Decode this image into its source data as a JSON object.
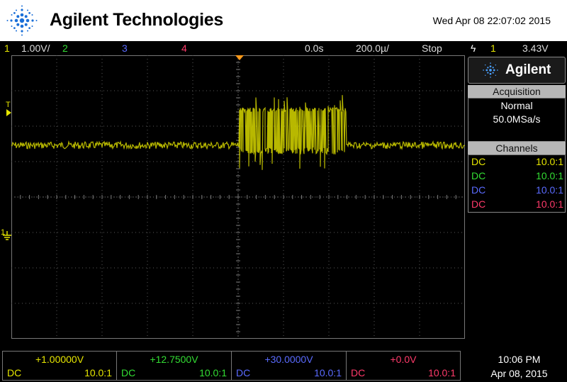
{
  "header": {
    "brand": "Agilent Technologies",
    "datetime": "Wed Apr 08 22:07:02 2015"
  },
  "status": {
    "ch1_num": "1",
    "ch1_scale": "1.00V/",
    "ch2_num": "2",
    "ch3_num": "3",
    "ch4_num": "4",
    "time_offset": "0.0s",
    "time_scale": "200.0µ/",
    "run_state": "Stop",
    "trigger_icon": "ϟ",
    "trigger_source": "1",
    "trigger_level": "3.43V"
  },
  "side": {
    "logo_text": "Agilent",
    "acq_header": "Acquisition",
    "acq_mode": "Normal",
    "sample_rate": "50.0MSa/s",
    "channels_header": "Channels",
    "channels": [
      {
        "coupling": "DC",
        "probe": "10.0:1",
        "color": "#e6e600"
      },
      {
        "coupling": "DC",
        "probe": "10.0:1",
        "color": "#33dd33"
      },
      {
        "coupling": "DC",
        "probe": "10.0:1",
        "color": "#5a6bff"
      },
      {
        "coupling": "DC",
        "probe": "10.0:1",
        "color": "#ff3a6a"
      }
    ]
  },
  "markers": {
    "trigger_level": "T",
    "ground": "1"
  },
  "bottom": {
    "channels": [
      {
        "offset": "+1.00000V",
        "coupling": "DC",
        "probe": "10.0:1",
        "color": "#e6e600"
      },
      {
        "offset": "+12.7500V",
        "coupling": "DC",
        "probe": "10.0:1",
        "color": "#33dd33"
      },
      {
        "offset": "+30.0000V",
        "coupling": "DC",
        "probe": "10.0:1",
        "color": "#5a6bff"
      },
      {
        "offset": "+0.0V",
        "coupling": "DC",
        "probe": "10.0:1",
        "color": "#ff3a6a"
      }
    ],
    "time": "10:06 PM",
    "date": "Apr 08, 2015"
  },
  "colors": {
    "trace": "#d8d800",
    "grid": "#5a5a5a"
  }
}
